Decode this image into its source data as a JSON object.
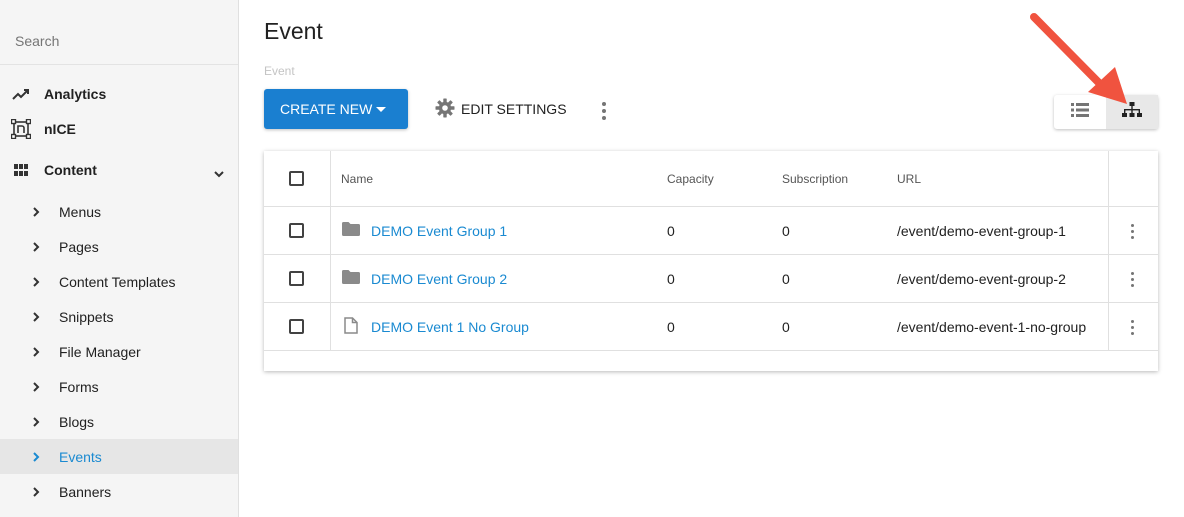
{
  "sidebar": {
    "search_placeholder": "Search",
    "top_items": [
      {
        "label": "Analytics",
        "icon": "trending-up-icon"
      },
      {
        "label": "nICE",
        "icon": "nice-logo-icon"
      },
      {
        "label": "Content",
        "icon": "grid-icon"
      }
    ],
    "sub_items": [
      {
        "label": "Menus"
      },
      {
        "label": "Pages"
      },
      {
        "label": "Content Templates"
      },
      {
        "label": "Snippets"
      },
      {
        "label": "File Manager"
      },
      {
        "label": "Forms"
      },
      {
        "label": "Blogs"
      },
      {
        "label": "Events",
        "active": true
      },
      {
        "label": "Banners"
      }
    ]
  },
  "main": {
    "title": "Event",
    "breadcrumb": "Event",
    "create_button": "CREATE NEW",
    "edit_settings_button": "EDIT SETTINGS"
  },
  "table": {
    "columns": [
      "Name",
      "Capacity",
      "Subscription",
      "URL"
    ],
    "rows": [
      {
        "name": "DEMO Event Group 1",
        "icon": "folder-icon",
        "capacity": "0",
        "subscription": "0",
        "url": "/event/demo-event-group-1"
      },
      {
        "name": "DEMO Event Group 2",
        "icon": "folder-icon",
        "capacity": "0",
        "subscription": "0",
        "url": "/event/demo-event-group-2"
      },
      {
        "name": "DEMO Event 1 No Group",
        "icon": "file-icon",
        "capacity": "0",
        "subscription": "0",
        "url": "/event/demo-event-1-no-group"
      }
    ]
  },
  "colors": {
    "accent": "#1a7fd0",
    "link": "#1a8ad1",
    "annotation_arrow": "#f0533f"
  }
}
